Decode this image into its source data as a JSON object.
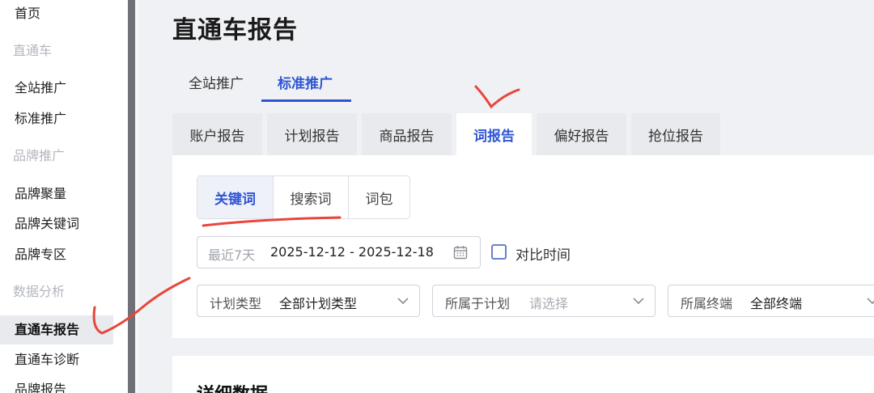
{
  "sidebar": {
    "items": [
      {
        "label": "首页",
        "kind": "item"
      },
      {
        "label": "直通车",
        "kind": "group"
      },
      {
        "label": "全站推广",
        "kind": "item"
      },
      {
        "label": "标准推广",
        "kind": "item"
      },
      {
        "label": "品牌推广",
        "kind": "group"
      },
      {
        "label": "品牌聚量",
        "kind": "item"
      },
      {
        "label": "品牌关键词",
        "kind": "item"
      },
      {
        "label": "品牌专区",
        "kind": "item"
      },
      {
        "label": "数据分析",
        "kind": "group"
      },
      {
        "label": "直通车报告",
        "kind": "item",
        "active": true
      },
      {
        "label": "直通车诊断",
        "kind": "item"
      },
      {
        "label": "品牌报告",
        "kind": "item"
      }
    ]
  },
  "page": {
    "title": "直通车报告"
  },
  "top_tabs": [
    {
      "label": "全站推广",
      "active": false
    },
    {
      "label": "标准推广",
      "active": true
    }
  ],
  "report_tabs": [
    {
      "label": "账户报告",
      "active": false
    },
    {
      "label": "计划报告",
      "active": false
    },
    {
      "label": "商品报告",
      "active": false
    },
    {
      "label": "词报告",
      "active": true
    },
    {
      "label": "偏好报告",
      "active": false
    },
    {
      "label": "抢位报告",
      "active": false
    }
  ],
  "sub_tabs": [
    {
      "label": "关键词",
      "active": true
    },
    {
      "label": "搜索词",
      "active": false
    },
    {
      "label": "词包",
      "active": false
    }
  ],
  "date_filter": {
    "preset": "最近7天",
    "range": "2025-12-12 - 2025-12-18",
    "icon": "calendar-icon"
  },
  "compare": {
    "label": "对比时间",
    "checked": false
  },
  "filters": [
    {
      "label": "计划类型",
      "value": "全部计划类型",
      "placeholder": false
    },
    {
      "label": "所属于计划",
      "value": "请选择",
      "placeholder": true
    },
    {
      "label": "所属终端",
      "value": "全部终端",
      "placeholder": false
    }
  ],
  "detail": {
    "title": "详细数据"
  },
  "colors": {
    "accent": "#2f55d4",
    "annotation": "#e8463c",
    "sidebar_active_bg": "#e8eaee",
    "page_bg": "#f0f1f4"
  }
}
